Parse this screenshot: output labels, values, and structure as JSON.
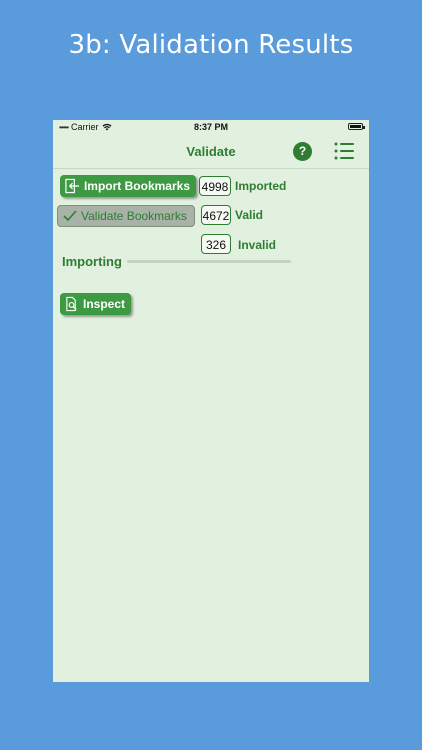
{
  "headline": "3b: Validation Results",
  "status_bar": {
    "carrier": "Carrier",
    "time": "8:37 PM"
  },
  "nav": {
    "title": "Validate",
    "help_label": "?"
  },
  "actions": {
    "import_label": "Import Bookmarks",
    "validate_label": "Validate Bookmarks",
    "inspect_label": "Inspect"
  },
  "counts": {
    "imported": {
      "value": "4998",
      "label": "Imported"
    },
    "valid": {
      "value": "4672",
      "label": "Valid"
    },
    "invalid": {
      "value": "326",
      "label": "Invalid"
    }
  },
  "progress": {
    "label": "Importing",
    "fraction": 0
  },
  "colors": {
    "background": "#5a9bdb",
    "app_background": "#e2f1df",
    "accent": "#2e7d32",
    "button_green": "#3d9a43"
  }
}
